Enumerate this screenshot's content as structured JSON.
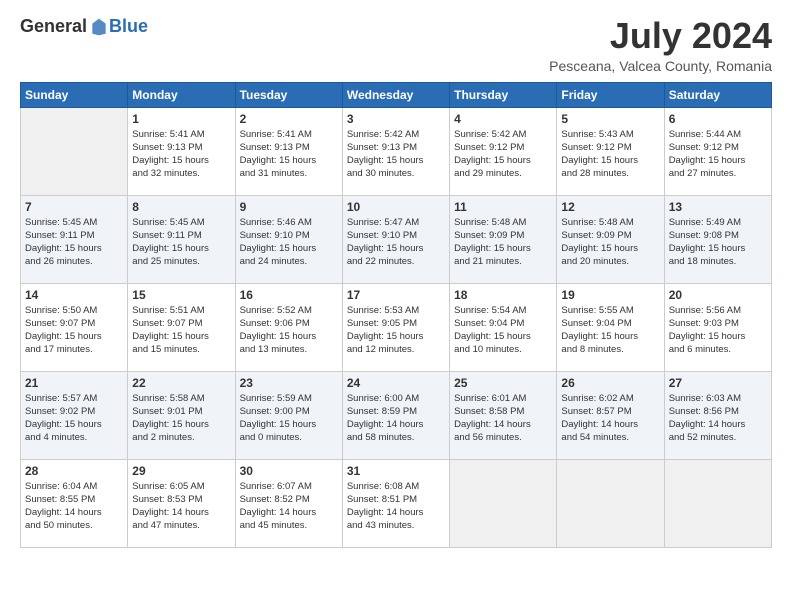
{
  "app": {
    "logo_general": "General",
    "logo_blue": "Blue",
    "month_title": "July 2024",
    "location": "Pesceana, Valcea County, Romania"
  },
  "calendar": {
    "headers": [
      "Sunday",
      "Monday",
      "Tuesday",
      "Wednesday",
      "Thursday",
      "Friday",
      "Saturday"
    ],
    "weeks": [
      [
        {
          "day": "",
          "info": ""
        },
        {
          "day": "1",
          "info": "Sunrise: 5:41 AM\nSunset: 9:13 PM\nDaylight: 15 hours\nand 32 minutes."
        },
        {
          "day": "2",
          "info": "Sunrise: 5:41 AM\nSunset: 9:13 PM\nDaylight: 15 hours\nand 31 minutes."
        },
        {
          "day": "3",
          "info": "Sunrise: 5:42 AM\nSunset: 9:13 PM\nDaylight: 15 hours\nand 30 minutes."
        },
        {
          "day": "4",
          "info": "Sunrise: 5:42 AM\nSunset: 9:12 PM\nDaylight: 15 hours\nand 29 minutes."
        },
        {
          "day": "5",
          "info": "Sunrise: 5:43 AM\nSunset: 9:12 PM\nDaylight: 15 hours\nand 28 minutes."
        },
        {
          "day": "6",
          "info": "Sunrise: 5:44 AM\nSunset: 9:12 PM\nDaylight: 15 hours\nand 27 minutes."
        }
      ],
      [
        {
          "day": "7",
          "info": "Sunrise: 5:45 AM\nSunset: 9:11 PM\nDaylight: 15 hours\nand 26 minutes."
        },
        {
          "day": "8",
          "info": "Sunrise: 5:45 AM\nSunset: 9:11 PM\nDaylight: 15 hours\nand 25 minutes."
        },
        {
          "day": "9",
          "info": "Sunrise: 5:46 AM\nSunset: 9:10 PM\nDaylight: 15 hours\nand 24 minutes."
        },
        {
          "day": "10",
          "info": "Sunrise: 5:47 AM\nSunset: 9:10 PM\nDaylight: 15 hours\nand 22 minutes."
        },
        {
          "day": "11",
          "info": "Sunrise: 5:48 AM\nSunset: 9:09 PM\nDaylight: 15 hours\nand 21 minutes."
        },
        {
          "day": "12",
          "info": "Sunrise: 5:48 AM\nSunset: 9:09 PM\nDaylight: 15 hours\nand 20 minutes."
        },
        {
          "day": "13",
          "info": "Sunrise: 5:49 AM\nSunset: 9:08 PM\nDaylight: 15 hours\nand 18 minutes."
        }
      ],
      [
        {
          "day": "14",
          "info": "Sunrise: 5:50 AM\nSunset: 9:07 PM\nDaylight: 15 hours\nand 17 minutes."
        },
        {
          "day": "15",
          "info": "Sunrise: 5:51 AM\nSunset: 9:07 PM\nDaylight: 15 hours\nand 15 minutes."
        },
        {
          "day": "16",
          "info": "Sunrise: 5:52 AM\nSunset: 9:06 PM\nDaylight: 15 hours\nand 13 minutes."
        },
        {
          "day": "17",
          "info": "Sunrise: 5:53 AM\nSunset: 9:05 PM\nDaylight: 15 hours\nand 12 minutes."
        },
        {
          "day": "18",
          "info": "Sunrise: 5:54 AM\nSunset: 9:04 PM\nDaylight: 15 hours\nand 10 minutes."
        },
        {
          "day": "19",
          "info": "Sunrise: 5:55 AM\nSunset: 9:04 PM\nDaylight: 15 hours\nand 8 minutes."
        },
        {
          "day": "20",
          "info": "Sunrise: 5:56 AM\nSunset: 9:03 PM\nDaylight: 15 hours\nand 6 minutes."
        }
      ],
      [
        {
          "day": "21",
          "info": "Sunrise: 5:57 AM\nSunset: 9:02 PM\nDaylight: 15 hours\nand 4 minutes."
        },
        {
          "day": "22",
          "info": "Sunrise: 5:58 AM\nSunset: 9:01 PM\nDaylight: 15 hours\nand 2 minutes."
        },
        {
          "day": "23",
          "info": "Sunrise: 5:59 AM\nSunset: 9:00 PM\nDaylight: 15 hours\nand 0 minutes."
        },
        {
          "day": "24",
          "info": "Sunrise: 6:00 AM\nSunset: 8:59 PM\nDaylight: 14 hours\nand 58 minutes."
        },
        {
          "day": "25",
          "info": "Sunrise: 6:01 AM\nSunset: 8:58 PM\nDaylight: 14 hours\nand 56 minutes."
        },
        {
          "day": "26",
          "info": "Sunrise: 6:02 AM\nSunset: 8:57 PM\nDaylight: 14 hours\nand 54 minutes."
        },
        {
          "day": "27",
          "info": "Sunrise: 6:03 AM\nSunset: 8:56 PM\nDaylight: 14 hours\nand 52 minutes."
        }
      ],
      [
        {
          "day": "28",
          "info": "Sunrise: 6:04 AM\nSunset: 8:55 PM\nDaylight: 14 hours\nand 50 minutes."
        },
        {
          "day": "29",
          "info": "Sunrise: 6:05 AM\nSunset: 8:53 PM\nDaylight: 14 hours\nand 47 minutes."
        },
        {
          "day": "30",
          "info": "Sunrise: 6:07 AM\nSunset: 8:52 PM\nDaylight: 14 hours\nand 45 minutes."
        },
        {
          "day": "31",
          "info": "Sunrise: 6:08 AM\nSunset: 8:51 PM\nDaylight: 14 hours\nand 43 minutes."
        },
        {
          "day": "",
          "info": ""
        },
        {
          "day": "",
          "info": ""
        },
        {
          "day": "",
          "info": ""
        }
      ]
    ]
  }
}
